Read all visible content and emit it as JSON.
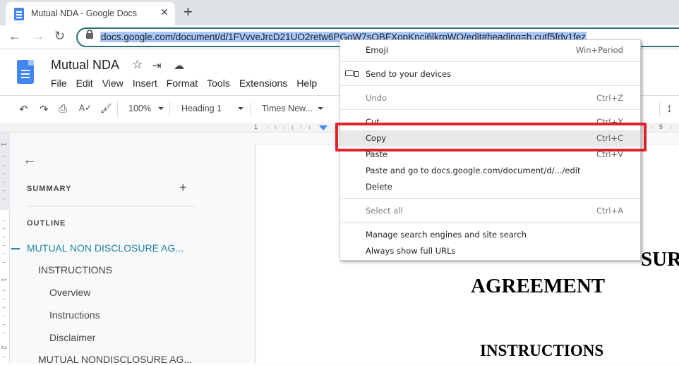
{
  "browser": {
    "tab": {
      "title": "Mutual NDA - Google Docs",
      "close_glyph": "✕"
    },
    "new_tab_glyph": "+",
    "nav": {
      "back_glyph": "←",
      "forward_glyph": "→",
      "reload_glyph": "↻"
    },
    "url": "docs.google.com/document/d/1FVvveJrcD21UO2retw6PGoW7sOBFXopKnci6lkrpWQ/edit#heading=h.cutf5fdv1fez"
  },
  "docs": {
    "title": "Mutual NDA",
    "icons": {
      "star": "☆",
      "move": "⇥",
      "cloud": "☁"
    },
    "menu": [
      "File",
      "Edit",
      "View",
      "Insert",
      "Format",
      "Tools",
      "Extensions",
      "Help"
    ],
    "toolbar": {
      "undo": "↶",
      "redo": "↷",
      "print": "⎙",
      "spellcheck": "A✓",
      "paint_format": "🖌",
      "zoom": "100%",
      "style": "Heading 1",
      "font": "Times New..."
    },
    "ruler": {
      "left_num": "1",
      "right_num": "5"
    },
    "vruler": {
      "nums": [
        "1",
        "1",
        "2"
      ]
    }
  },
  "sidebar": {
    "back_glyph": "←",
    "summary_label": "SUMMARY",
    "summary_add_glyph": "+",
    "outline_label": "OUTLINE",
    "outline": [
      {
        "text": "MUTUAL NON DISCLOSURE AG...",
        "level": 1,
        "active": true
      },
      {
        "text": "INSTRUCTIONS",
        "level": 2,
        "active": false
      },
      {
        "text": "Overview",
        "level": 3,
        "active": false
      },
      {
        "text": "Instructions",
        "level": 3,
        "active": false
      },
      {
        "text": "Disclaimer",
        "level": 3,
        "active": false
      },
      {
        "text": "MUTUAL NONDISCLOSURE AG...",
        "level": 2,
        "active": false
      }
    ]
  },
  "document": {
    "title_line1_fragment": "SUR",
    "title_line2": "AGREEMENT",
    "heading": "INSTRUCTIONS"
  },
  "context_menu": {
    "items": [
      {
        "label": "Emoji",
        "shortcut": "Win+Period",
        "disabled": false
      },
      {
        "label": "Send to your devices",
        "shortcut": "",
        "disabled": false,
        "icon": "devices-icon"
      },
      {
        "label": "Undo",
        "shortcut": "Ctrl+Z",
        "disabled": true
      },
      {
        "label": "Cut",
        "shortcut": "Ctrl+X",
        "disabled": false
      },
      {
        "label": "Copy",
        "shortcut": "Ctrl+C",
        "disabled": false,
        "highlighted": true
      },
      {
        "label": "Paste",
        "shortcut": "Ctrl+V",
        "disabled": false
      },
      {
        "label": "Paste and go to docs.google.com/document/d/.../edit",
        "shortcut": "",
        "disabled": false
      },
      {
        "label": "Delete",
        "shortcut": "",
        "disabled": false
      },
      {
        "label": "Select all",
        "shortcut": "Ctrl+A",
        "disabled": true
      },
      {
        "label": "Manage search engines and site search",
        "shortcut": "",
        "disabled": false
      },
      {
        "label": "Always show full URLs",
        "shortcut": "",
        "disabled": false
      }
    ]
  },
  "colors": {
    "highlight_box": "#e0212b",
    "url_selection": "#a8c7fa",
    "outline_active": "#1f7fa5",
    "docs_blue": "#4285f4"
  }
}
